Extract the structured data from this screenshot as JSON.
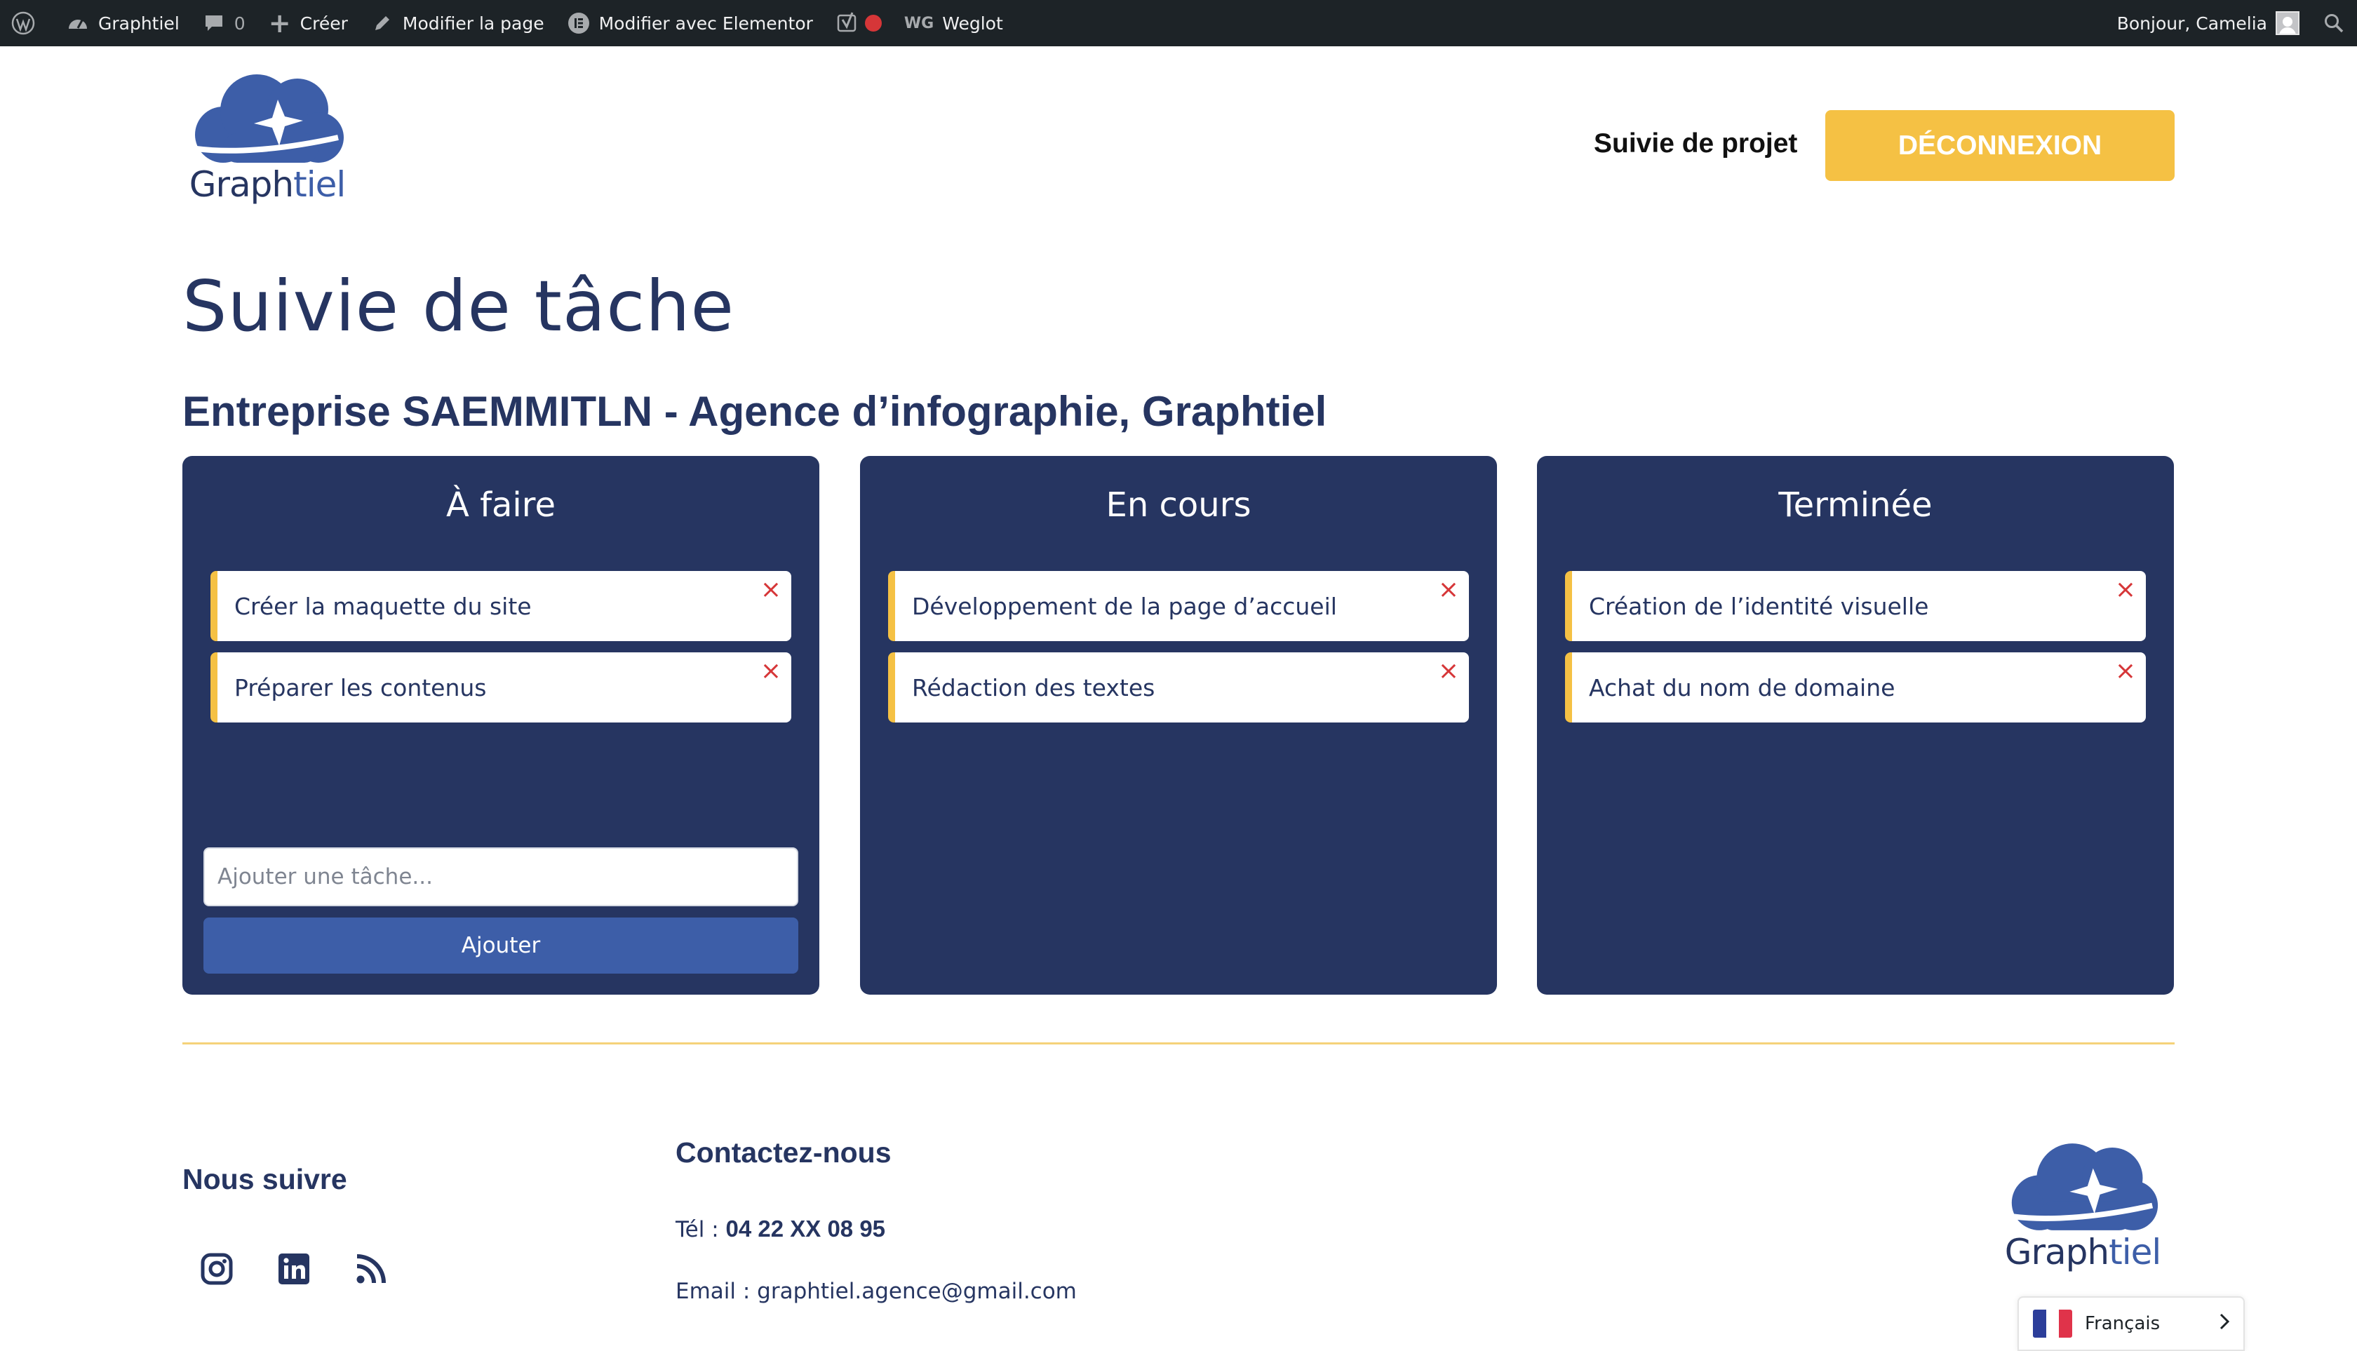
{
  "admin_bar": {
    "site_name": "Graphtiel",
    "comments_count": "0",
    "create_label": "Créer",
    "edit_page_label": "Modifier la page",
    "elementor_label": "Modifier avec Elementor",
    "weglot_label": "Weglot",
    "greeting": "Bonjour, Camelia"
  },
  "header": {
    "logo_text_left": "Graph",
    "logo_text_right": "tiel",
    "nav_link": "Suivie de projet",
    "logout_label": "DÉCONNEXION"
  },
  "main": {
    "title": "Suivie de tâche",
    "subtitle": "Entreprise SAEMMITLN - Agence d’infographie, Graphtiel",
    "columns": [
      {
        "title": "À faire",
        "tasks": [
          "Créer la maquette du site",
          "Préparer les contenus"
        ]
      },
      {
        "title": "En cours",
        "tasks": [
          "Développement de la page d’accueil",
          "Rédaction des textes"
        ]
      },
      {
        "title": "Terminée",
        "tasks": [
          "Création de l’identité visuelle",
          "Achat du nom de domaine"
        ]
      }
    ],
    "add_task_placeholder": "Ajouter une tâche...",
    "add_button_label": "Ajouter",
    "remove_glyph": "×"
  },
  "footer": {
    "follow_heading": "Nous suivre",
    "contact_heading": "Contactez-nous",
    "tel_label": "Tél : ",
    "tel_value": "04 22 XX 08 95",
    "email_line": "Email : graphtiel.agence@gmail.com",
    "language": "Français"
  },
  "colors": {
    "navy": "#263561",
    "accent_yellow": "#f5c144",
    "button_blue": "#3d5ea8",
    "admin_bar": "#1d2327"
  },
  "icons": [
    "wordpress-icon",
    "dashboard-icon",
    "comment-icon",
    "plus-icon",
    "pencil-icon",
    "elementor-icon",
    "yoast-icon",
    "weglot-icon",
    "search-icon",
    "close-icon",
    "instagram-icon",
    "linkedin-icon",
    "rss-icon",
    "france-flag-icon",
    "chevron-right-icon"
  ]
}
